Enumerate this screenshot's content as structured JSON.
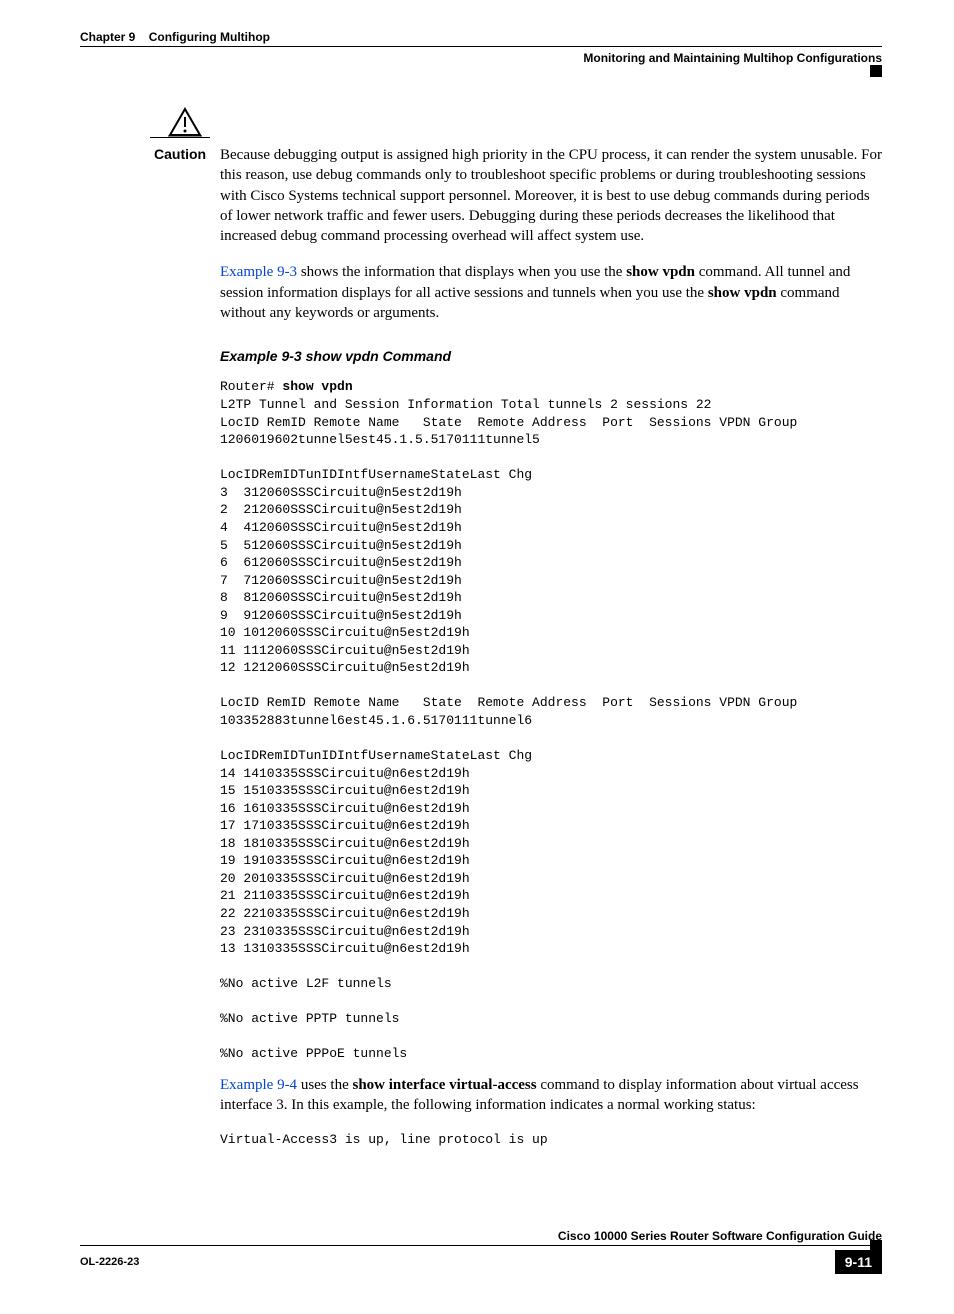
{
  "header": {
    "chapter_label": "Chapter 9",
    "chapter_title": "Configuring Multihop",
    "section_title": "Monitoring and Maintaining Multihop Configurations"
  },
  "caution": {
    "label": "Caution",
    "text": "Because debugging output is assigned high priority in the CPU process, it can render the system unusable. For this reason, use debug commands only to troubleshoot specific problems or during troubleshooting sessions with Cisco Systems technical support personnel. Moreover, it is best to use debug commands during periods of lower network traffic and fewer users. Debugging during these periods decreases the likelihood that increased debug command processing overhead will affect system use."
  },
  "intro_para": {
    "link": "Example 9-3",
    "part1": " shows the information that displays when you use the ",
    "bold1": "show vpdn",
    "part2": " command. All tunnel and session information displays for all active sessions and tunnels when you use the ",
    "bold2": "show vpdn",
    "part3": " command without any keywords or arguments."
  },
  "example": {
    "title": "Example 9-3    show vpdn Command",
    "prompt": "Router# ",
    "command": "show vpdn",
    "output": "L2TP Tunnel and Session Information Total tunnels 2 sessions 22\nLocID RemID Remote Name   State  Remote Address  Port  Sessions VPDN Group\n1206019602tunnel5est45.1.5.5170111tunnel5\n\nLocIDRemIDTunIDIntfUsernameStateLast Chg\n3  312060SSSCircuitu@n5est2d19h\n2  212060SSSCircuitu@n5est2d19h\n4  412060SSSCircuitu@n5est2d19h\n5  512060SSSCircuitu@n5est2d19h\n6  612060SSSCircuitu@n5est2d19h\n7  712060SSSCircuitu@n5est2d19h\n8  812060SSSCircuitu@n5est2d19h\n9  912060SSSCircuitu@n5est2d19h\n10 1012060SSSCircuitu@n5est2d19h\n11 1112060SSSCircuitu@n5est2d19h\n12 1212060SSSCircuitu@n5est2d19h\n\nLocID RemID Remote Name   State  Remote Address  Port  Sessions VPDN Group\n103352883tunnel6est45.1.6.5170111tunnel6\n\nLocIDRemIDTunIDIntfUsernameStateLast Chg\n14 1410335SSSCircuitu@n6est2d19h\n15 1510335SSSCircuitu@n6est2d19h\n16 1610335SSSCircuitu@n6est2d19h\n17 1710335SSSCircuitu@n6est2d19h\n18 1810335SSSCircuitu@n6est2d19h\n19 1910335SSSCircuitu@n6est2d19h\n20 2010335SSSCircuitu@n6est2d19h\n21 2110335SSSCircuitu@n6est2d19h\n22 2210335SSSCircuitu@n6est2d19h\n23 2310335SSSCircuitu@n6est2d19h\n13 1310335SSSCircuitu@n6est2d19h\n\n%No active L2F tunnels\n\n%No active PPTP tunnels\n\n%No active PPPoE tunnels"
  },
  "followup": {
    "link": "Example 9-4",
    "part1": " uses the ",
    "bold1": "show interface virtual-access",
    "part2": " command to display information about virtual access interface 3. In this example, the following information indicates a normal working status:",
    "code": "Virtual-Access3 is up, line protocol is up"
  },
  "footer": {
    "guide": "Cisco 10000 Series Router Software Configuration Guide",
    "doc_id": "OL-2226-23",
    "page": "9-11"
  }
}
